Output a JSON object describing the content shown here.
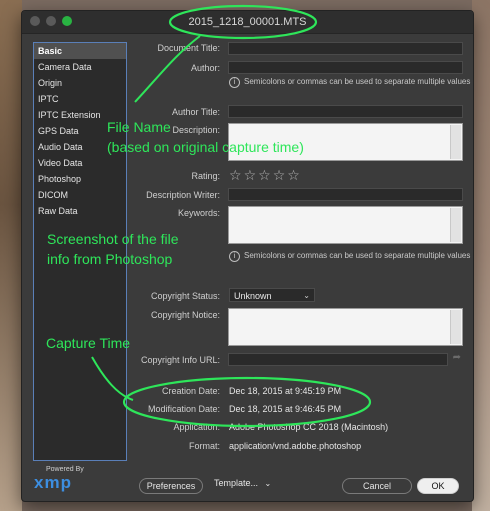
{
  "window": {
    "title": "2015_1218_00001.MTS"
  },
  "sidebar": {
    "items": [
      {
        "label": "Basic",
        "selected": true
      },
      {
        "label": "Camera Data"
      },
      {
        "label": "Origin"
      },
      {
        "label": "IPTC"
      },
      {
        "label": "IPTC Extension"
      },
      {
        "label": "GPS Data"
      },
      {
        "label": "Audio Data"
      },
      {
        "label": "Video Data"
      },
      {
        "label": "Photoshop"
      },
      {
        "label": "DICOM"
      },
      {
        "label": "Raw Data"
      }
    ]
  },
  "fields": {
    "document_title": "Document Title:",
    "author": "Author:",
    "author_hint": "Semicolons or commas can be used to separate multiple values",
    "author_title": "Author Title:",
    "description": "Description:",
    "rating": "Rating:",
    "rating_value": 0,
    "rating_max": 5,
    "description_writer": "Description Writer:",
    "keywords": "Keywords:",
    "keywords_hint": "Semicolons or commas can be used to separate multiple values",
    "copyright_status": "Copyright Status:",
    "copyright_status_value": "Unknown",
    "copyright_notice": "Copyright Notice:",
    "copyright_info_url": "Copyright Info URL:",
    "creation_date": "Creation Date:",
    "creation_date_value": "Dec 18, 2015 at 9:45:19 PM",
    "modification_date": "Modification Date:",
    "modification_date_value": "Dec 18, 2015 at 9:46:45 PM",
    "application": "Application:",
    "application_value": "Adobe Photoshop CC 2018 (Macintosh)",
    "format": "Format:",
    "format_value": "application/vnd.adobe.photoshop"
  },
  "footer": {
    "powered_by": "Powered By",
    "xmp": "xmp",
    "preferences": "Preferences",
    "template": "Template...",
    "cancel": "Cancel",
    "ok": "OK"
  },
  "annotations": {
    "file_name_line1": "File Name",
    "file_name_line2": "(based on original capture time)",
    "screenshot_line1": "Screenshot of the file",
    "screenshot_line2": "info from Photoshop",
    "capture_time": "Capture Time",
    "color": "#2ee65a"
  },
  "icons": {
    "info": "info-icon",
    "star": "star-icon",
    "chevron": "chevron-down-icon",
    "arrow": "arrow-right-icon"
  }
}
